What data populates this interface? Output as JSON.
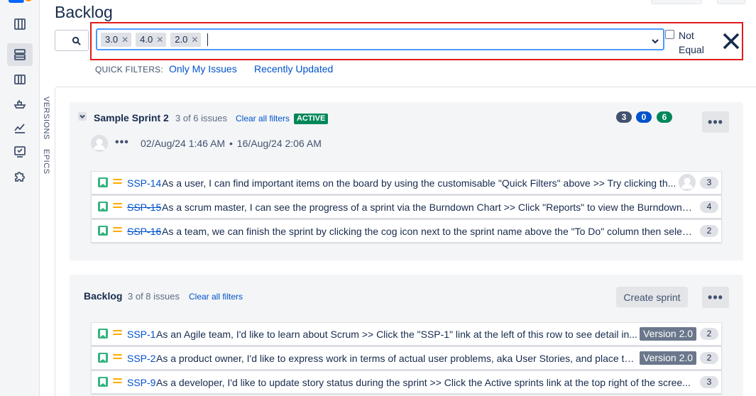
{
  "header": {
    "title": "Backlog"
  },
  "filter": {
    "chips": [
      "3.0",
      "4.0",
      "2.0"
    ],
    "not_equal_label": "Not Equal",
    "not_equal_checked": false
  },
  "quick_filters": {
    "label": "QUICK FILTERS:",
    "items": [
      "Only My Issues",
      "Recently Updated"
    ]
  },
  "side_tabs": [
    "VERSIONS",
    "EPICS"
  ],
  "sprint": {
    "name": "Sample Sprint 2",
    "issue_count": "3 of 6 issues",
    "clear_filters": "Clear all filters",
    "status": "ACTIVE",
    "counts": [
      {
        "value": "3",
        "color": "#42526e"
      },
      {
        "value": "0",
        "color": "#0052cc"
      },
      {
        "value": "6",
        "color": "#00875a"
      }
    ],
    "more": "•••",
    "dates_more": "•••",
    "start": "02/Aug/24 1:46 AM",
    "date_sep": "•",
    "end": "16/Aug/24 2:06 AM",
    "issues": [
      {
        "key": "SSP-14",
        "done": false,
        "summary": "As a user, I can find important items on the board by using the customisable \"Quick Filters\" above >> Try clicking th...",
        "estimate": "3",
        "has_avatar": true
      },
      {
        "key": "SSP-15",
        "done": true,
        "summary": "As a scrum master, I can see the progress of a sprint via the Burndown Chart >> Click \"Reports\" to view the Burndown C...",
        "estimate": "4",
        "has_avatar": false
      },
      {
        "key": "SSP-16",
        "done": true,
        "summary": "As a team, we can finish the sprint by clicking the cog icon next to the sprint name above the \"To Do\" column then select...",
        "estimate": "2",
        "has_avatar": false
      }
    ]
  },
  "backlog": {
    "title": "Backlog",
    "issue_count": "3 of 8 issues",
    "clear_filters": "Clear all filters",
    "create_sprint": "Create sprint",
    "more": "•••",
    "issues": [
      {
        "key": "SSP-1",
        "summary": "As an Agile team, I'd like to learn about Scrum >> Click the \"SSP-1\" link at the left of this row to see detail in...",
        "version": "Version 2.0",
        "estimate": "2"
      },
      {
        "key": "SSP-2",
        "summary": "As a product owner, I'd like to express work in terms of actual user problems, aka User Stories, and place the...",
        "version": "Version 2.0",
        "estimate": "2"
      },
      {
        "key": "SSP-9",
        "summary": "As a developer, I'd like to update story status during the sprint >> Click the Active sprints link at the top right of the scree...",
        "version": "",
        "estimate": "3"
      }
    ]
  }
}
